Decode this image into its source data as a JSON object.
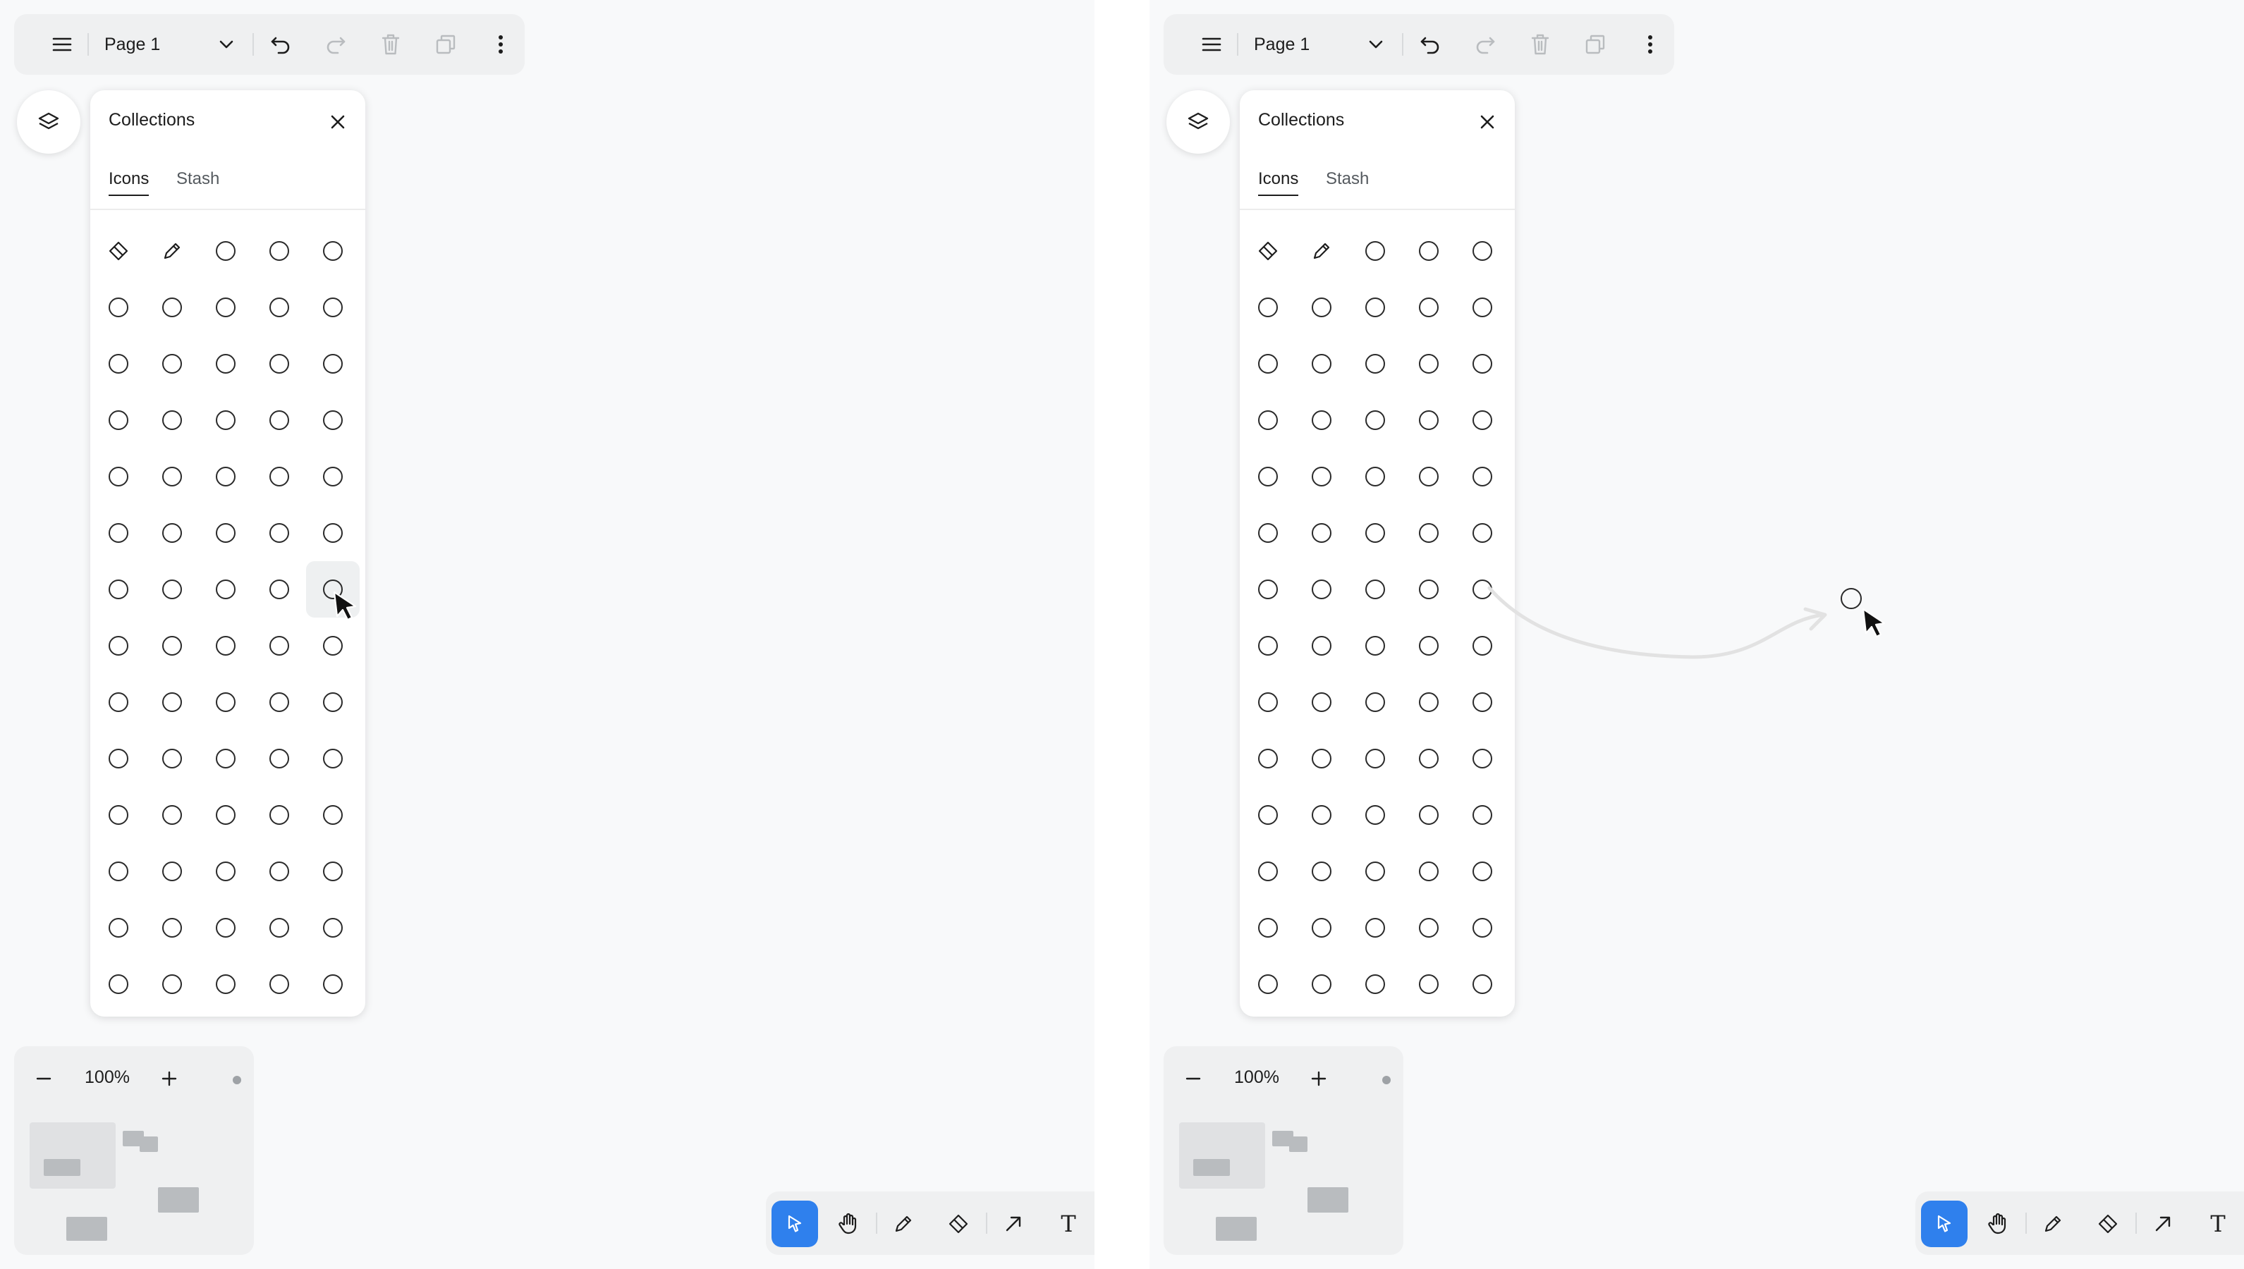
{
  "toolbar": {
    "page_name": "Page 1",
    "icons": [
      "hamburger-icon",
      "chevron-down-icon",
      "undo-icon",
      "redo-icon",
      "trash-icon",
      "duplicate-icon",
      "more-vertical-icon"
    ]
  },
  "collections": {
    "title": "Collections",
    "tabs": [
      {
        "label": "Icons",
        "active": true
      },
      {
        "label": "Stash",
        "active": false
      }
    ],
    "grid_rows": 14,
    "grid_cols": 5,
    "first_row_icons": [
      "eraser-icon",
      "pencil-icon",
      "circle-icon",
      "circle-icon",
      "circle-icon"
    ],
    "other_icons": "circle-icon",
    "hovered_item": {
      "row": 7,
      "col": 5
    }
  },
  "zoom": {
    "level": "100%",
    "minus_icon": "minus-icon",
    "plus_icon": "plus-icon"
  },
  "tools": [
    {
      "name": "select",
      "icon": "select-cursor-icon",
      "active": true
    },
    {
      "name": "hand",
      "icon": "hand-icon",
      "active": false
    },
    {
      "name": "draw",
      "icon": "pencil-icon",
      "active": false
    },
    {
      "name": "eraser",
      "icon": "eraser-icon",
      "active": false
    },
    {
      "name": "arrow",
      "icon": "arrow-icon",
      "active": false
    },
    {
      "name": "text",
      "icon": "text-icon",
      "label": "T",
      "active": false
    }
  ],
  "colors": {
    "canvas": "#f8f9fa",
    "panel": "#ffffff",
    "chrome": "#eff0f1",
    "accent": "#2f80ed",
    "minimap_block": "#b9bcbf"
  }
}
